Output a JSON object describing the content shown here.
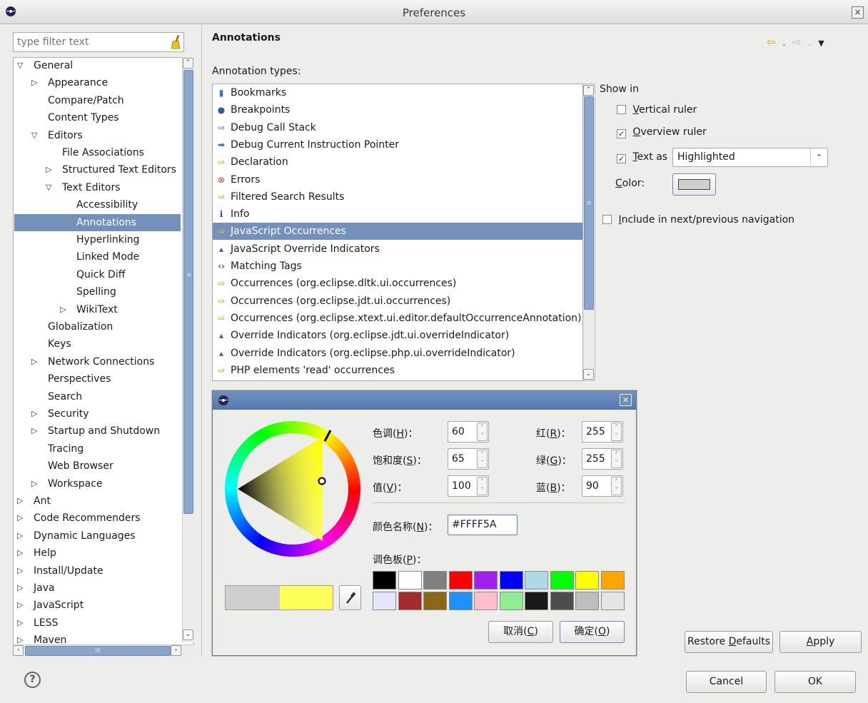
{
  "window": {
    "title": "Preferences",
    "close": "×"
  },
  "filter": {
    "placeholder": "type filter text"
  },
  "tree": [
    {
      "label": "General",
      "level": 0,
      "toggle": "▽"
    },
    {
      "label": "Appearance",
      "level": 1,
      "toggle": "▷"
    },
    {
      "label": "Compare/Patch",
      "level": 1,
      "toggle": ""
    },
    {
      "label": "Content Types",
      "level": 1,
      "toggle": ""
    },
    {
      "label": "Editors",
      "level": 1,
      "toggle": "▽"
    },
    {
      "label": "File Associations",
      "level": 2,
      "toggle": ""
    },
    {
      "label": "Structured Text Editors",
      "level": 2,
      "toggle": "▷"
    },
    {
      "label": "Text Editors",
      "level": 2,
      "toggle": "▽"
    },
    {
      "label": "Accessibility",
      "level": 3,
      "toggle": ""
    },
    {
      "label": "Annotations",
      "level": 3,
      "toggle": "",
      "selected": true
    },
    {
      "label": "Hyperlinking",
      "level": 3,
      "toggle": ""
    },
    {
      "label": "Linked Mode",
      "level": 3,
      "toggle": ""
    },
    {
      "label": "Quick Diff",
      "level": 3,
      "toggle": ""
    },
    {
      "label": "Spelling",
      "level": 3,
      "toggle": ""
    },
    {
      "label": "WikiText",
      "level": 3,
      "toggle": "▷"
    },
    {
      "label": "Globalization",
      "level": 1,
      "toggle": ""
    },
    {
      "label": "Keys",
      "level": 1,
      "toggle": ""
    },
    {
      "label": "Network Connections",
      "level": 1,
      "toggle": "▷"
    },
    {
      "label": "Perspectives",
      "level": 1,
      "toggle": ""
    },
    {
      "label": "Search",
      "level": 1,
      "toggle": ""
    },
    {
      "label": "Security",
      "level": 1,
      "toggle": "▷"
    },
    {
      "label": "Startup and Shutdown",
      "level": 1,
      "toggle": "▷"
    },
    {
      "label": "Tracing",
      "level": 1,
      "toggle": ""
    },
    {
      "label": "Web Browser",
      "level": 1,
      "toggle": ""
    },
    {
      "label": "Workspace",
      "level": 1,
      "toggle": "▷"
    },
    {
      "label": "Ant",
      "level": 0,
      "toggle": "▷"
    },
    {
      "label": "Code Recommenders",
      "level": 0,
      "toggle": "▷"
    },
    {
      "label": "Dynamic Languages",
      "level": 0,
      "toggle": "▷"
    },
    {
      "label": "Help",
      "level": 0,
      "toggle": "▷"
    },
    {
      "label": "Install/Update",
      "level": 0,
      "toggle": "▷"
    },
    {
      "label": "Java",
      "level": 0,
      "toggle": "▷"
    },
    {
      "label": "JavaScript",
      "level": 0,
      "toggle": "▷"
    },
    {
      "label": "LESS",
      "level": 0,
      "toggle": "▷"
    },
    {
      "label": "Maven",
      "level": 0,
      "toggle": "▷"
    }
  ],
  "page": {
    "title": "Annotations",
    "annotation_types_label": "Annotation types:"
  },
  "annotation_types": [
    {
      "label": "Bookmarks",
      "icon": "bookmark-icon",
      "glyph": "▮",
      "color": "#3b6cc4"
    },
    {
      "label": "Breakpoints",
      "icon": "breakpoint-icon",
      "glyph": "●",
      "color": "#3b5b9a"
    },
    {
      "label": "Debug Call Stack",
      "icon": "arrow-outline-icon",
      "glyph": "⇨",
      "color": "#3b6cc4"
    },
    {
      "label": "Debug Current Instruction Pointer",
      "icon": "arrow-filled-icon",
      "glyph": "➡",
      "color": "#3b6cc4"
    },
    {
      "label": "Declaration",
      "icon": "arrow-yellow-icon",
      "glyph": "⇨",
      "color": "#d9a400"
    },
    {
      "label": "Errors",
      "icon": "error-icon",
      "glyph": "⊗",
      "color": "#d33"
    },
    {
      "label": "Filtered Search Results",
      "icon": "arrow-yellow-icon",
      "glyph": "⇨",
      "color": "#d9a400"
    },
    {
      "label": "Info",
      "icon": "info-icon",
      "glyph": "i",
      "color": "#2a4a8a"
    },
    {
      "label": "JavaScript Occurrences",
      "icon": "arrow-yellow-icon",
      "glyph": "⇨",
      "color": "#f5d000",
      "selected": true
    },
    {
      "label": "JavaScript Override Indicators",
      "icon": "triangle-icon",
      "glyph": "▴",
      "color": "#3b5b9a"
    },
    {
      "label": "Matching Tags",
      "icon": "tag-icon",
      "glyph": "‹›",
      "color": "#222"
    },
    {
      "label": "Occurrences (org.eclipse.dltk.ui.occurrences)",
      "icon": "arrow-yellow-icon",
      "glyph": "⇨",
      "color": "#d9a400"
    },
    {
      "label": "Occurrences (org.eclipse.jdt.ui.occurrences)",
      "icon": "arrow-yellow-icon",
      "glyph": "⇨",
      "color": "#d9a400"
    },
    {
      "label": "Occurrences (org.eclipse.xtext.ui.editor.defaultOccurrenceAnnotation)",
      "icon": "arrow-yellow-icon",
      "glyph": "⇨",
      "color": "#d9a400"
    },
    {
      "label": "Override Indicators (org.eclipse.jdt.ui.overrideIndicator)",
      "icon": "triangle-icon",
      "glyph": "▴",
      "color": "#3b5b9a"
    },
    {
      "label": "Override Indicators (org.eclipse.php.ui.overrideIndicator)",
      "icon": "triangle-icon",
      "glyph": "▴",
      "color": "#3b5b9a"
    },
    {
      "label": "PHP elements 'read' occurrences",
      "icon": "arrow-yellow-icon",
      "glyph": "⇨",
      "color": "#d9a400"
    }
  ],
  "show_in": {
    "title": "Show in",
    "vertical_ruler": {
      "pre": "",
      "mn": "V",
      "post": "ertical ruler",
      "checked": false
    },
    "overview_ruler": {
      "pre": "",
      "mn": "O",
      "post": "verview ruler",
      "checked": true
    },
    "text_as": {
      "pre": "",
      "mn": "T",
      "post": "ext as",
      "checked": true,
      "value": "Highlighted"
    },
    "color": {
      "pre": "",
      "mn": "C",
      "post": "olor:"
    },
    "color_value": "#cfcfcf",
    "include_nav": {
      "pre": "",
      "mn": "I",
      "post": "nclude in next/previous navigation",
      "checked": false
    }
  },
  "color_dialog": {
    "close": "✕",
    "hue": {
      "label_pre": "色调(",
      "mn": "H",
      "label_post": ")：",
      "value": "60"
    },
    "saturation": {
      "label_pre": "饱和度(",
      "mn": "S",
      "label_post": ")：",
      "value": "65"
    },
    "value": {
      "label_pre": "值(",
      "mn": "V",
      "label_post": ")：",
      "value": "100"
    },
    "red": {
      "label_pre": "红(",
      "mn": "R",
      "label_post": ")：",
      "value": "255"
    },
    "green": {
      "label_pre": "绿(",
      "mn": "G",
      "label_post": ")：",
      "value": "255"
    },
    "blue": {
      "label_pre": "蓝(",
      "mn": "B",
      "label_post": ")：",
      "value": "90"
    },
    "name": {
      "label_pre": "颜色名称(",
      "mn": "N",
      "label_post": ")：",
      "value": "#FFFF5A"
    },
    "palette_label": {
      "pre": "调色板(",
      "mn": "P",
      "post": ")："
    },
    "palette": [
      "#000000",
      "#ffffff",
      "#808080",
      "#ff0000",
      "#a020f0",
      "#0000ff",
      "#add8e6",
      "#00ff00",
      "#ffff00",
      "#ffa500",
      "#e6e6fa",
      "#a52a2a",
      "#8b6914",
      "#1e90ff",
      "#ffc0cb",
      "#90ee90",
      "#1a1a1a",
      "#4d4d4d",
      "#bebebe",
      "#e5e5e5"
    ],
    "current_color": "#cfcfcf",
    "new_color": "#ffff5a",
    "cancel": {
      "pre": "取消(",
      "mn": "C",
      "post": ")"
    },
    "ok": {
      "pre": "确定(",
      "mn": "O",
      "post": ")"
    }
  },
  "buttons": {
    "restore_defaults": {
      "pre": "Restore ",
      "mn": "D",
      "post": "efaults"
    },
    "apply": {
      "pre": "",
      "mn": "A",
      "post": "pply"
    },
    "cancel": "Cancel",
    "ok": "OK"
  }
}
